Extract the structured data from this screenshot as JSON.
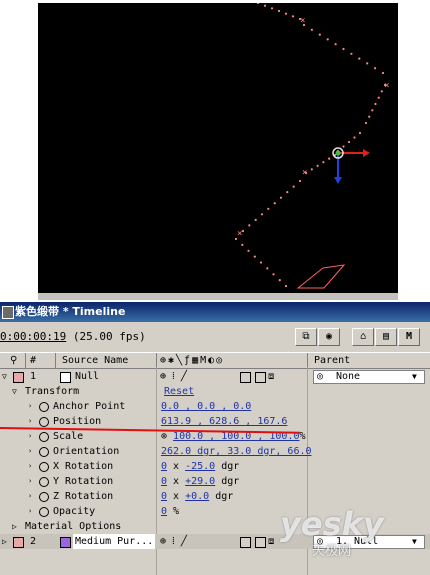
{
  "window": {
    "title": "紫色缎带 * Timeline"
  },
  "toolbar": {
    "timecode": "0:00:00:19",
    "fps": "(25.00 fps)",
    "btn_m": "M"
  },
  "header": {
    "num": "#",
    "source_name": "Source Name",
    "parent": "Parent"
  },
  "layers": [
    {
      "index": "1",
      "name": "Null",
      "label_color": "#e8a8a8",
      "parent_value": "None"
    },
    {
      "index": "2",
      "name": "Medium Pur...",
      "label_color": "#e8a8a8",
      "swatch_color": "#9966dd",
      "parent_value": "1. Null"
    }
  ],
  "transform": {
    "group_label": "Transform",
    "reset_label": "Reset",
    "props": [
      {
        "name": "Anchor Point",
        "value": "0.0 , 0.0 , 0.0"
      },
      {
        "name": "Position",
        "value": "613.9 , 628.6 , 167.6"
      },
      {
        "name": "Scale",
        "value": "100.0 , 100.0 , 100.0",
        "unit": "%"
      },
      {
        "name": "Orientation",
        "value": "262.0 dgr, 33.0 dgr, 66.0"
      },
      {
        "name": "X Rotation",
        "prefix": "0",
        "mid": " x ",
        "value": "-25.0",
        "unit": " dgr"
      },
      {
        "name": "Y Rotation",
        "prefix": "0",
        "mid": " x ",
        "value": "+29.0",
        "unit": " dgr"
      },
      {
        "name": "Z Rotation",
        "prefix": "0",
        "mid": " x ",
        "value": "+0.0",
        "unit": " dgr"
      },
      {
        "name": "Opacity",
        "value": "0",
        "unit": " %"
      }
    ]
  },
  "material_options": "Material Options",
  "watermark": {
    "logo": "yesky",
    "sub": "天极网"
  },
  "colors": {
    "accent_red": "#e01010",
    "value_blue": "#1f33a6",
    "motion_path": "#ff8a80"
  }
}
